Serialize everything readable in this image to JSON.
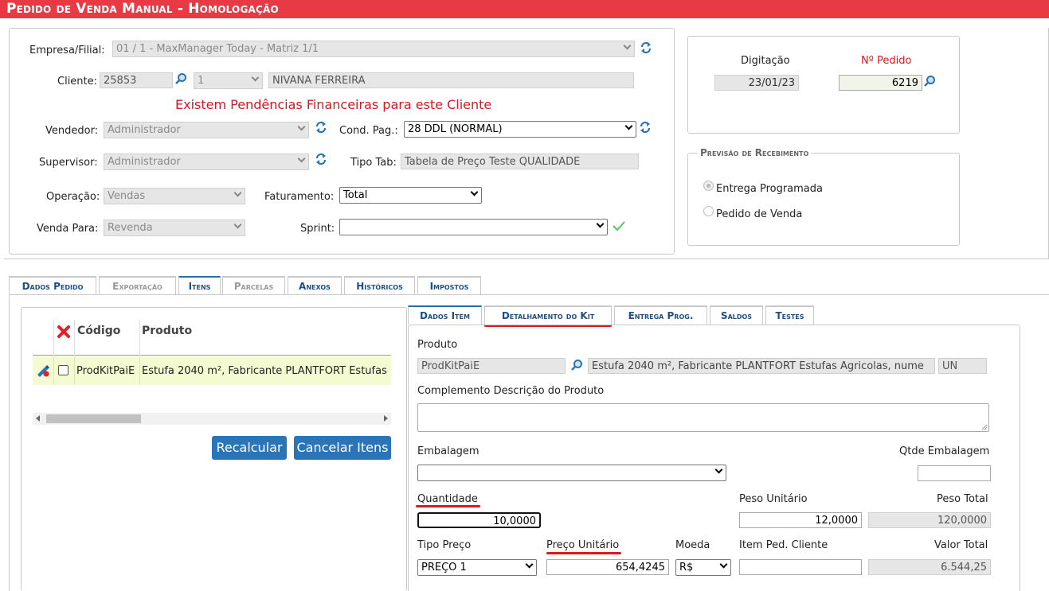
{
  "title": "Pedido de Venda Manual  - Homologação",
  "header": {
    "empresa_label": "Empresa/Filial:",
    "empresa_value": "01 / 1 - MaxManager Today - Matriz 1/1",
    "cliente_label": "Cliente:",
    "cliente_code": "25853",
    "cliente_branch": "1",
    "cliente_name": "NIVANA FERREIRA",
    "pendencias_msg": "Existem Pendências Financeiras para este Cliente",
    "vendedor_label": "Vendedor:",
    "vendedor_value": "Administrador",
    "cond_pag_label": "Cond. Pag.:",
    "cond_pag_value": "28 DDL (NORMAL)",
    "supervisor_label": "Supervisor:",
    "supervisor_value": "Administrador",
    "tipo_tab_label": "Tipo Tab:",
    "tipo_tab_value": "Tabela de Preço Teste QUALIDADE",
    "operacao_label": "Operação:",
    "operacao_value": "Vendas",
    "faturamento_label": "Faturamento:",
    "faturamento_value": "Total",
    "venda_para_label": "Venda Para:",
    "venda_para_value": "Revenda",
    "sprint_label": "Sprint:",
    "sprint_value": ""
  },
  "order_box": {
    "digitacao_label": "Digitação",
    "digitacao_value": "23/01/23",
    "pedido_label": "Nº Pedido",
    "pedido_value": "6219"
  },
  "previsao": {
    "legend": "Previsão de Recebimento",
    "option1": "Entrega Programada",
    "option2": "Pedido de Venda"
  },
  "main_tabs": [
    {
      "label": "Dados Pedido",
      "state": "normal"
    },
    {
      "label": "Exportação",
      "state": "disabled"
    },
    {
      "label": "Itens",
      "state": "active"
    },
    {
      "label": "Parcelas",
      "state": "disabled"
    },
    {
      "label": "Anexos",
      "state": "normal"
    },
    {
      "label": "Históricos",
      "state": "normal"
    },
    {
      "label": "Impostos",
      "state": "normal"
    }
  ],
  "items_grid": {
    "col_codigo": "Código",
    "col_produto": "Produto",
    "row_codigo": "ProdKitPaiE",
    "row_produto": "Estufa 2040 m², Fabricante PLANTFORT Estufas"
  },
  "buttons": {
    "recalcular": "Recalcular",
    "cancelar": "Cancelar Itens"
  },
  "sub_tabs": [
    {
      "label": "Dados Item"
    },
    {
      "label": "Detalhamento do Kit"
    },
    {
      "label": "Entrega Prog."
    },
    {
      "label": "Saldos"
    },
    {
      "label": "Testes"
    }
  ],
  "item": {
    "produto_label": "Produto",
    "produto_code": "ProdKitPaiE",
    "produto_desc": "Estufa 2040 m², Fabricante PLANTFORT Estufas Agricolas, nume",
    "produto_unit": "UN",
    "complemento_label": "Complemento Descrição do Produto",
    "embalagem_label": "Embalagem",
    "qtde_embalagem_label": "Qtde Embalagem",
    "quantidade_label": "Quantidade",
    "quantidade_value": "10,0000",
    "peso_unit_label": "Peso Unitário",
    "peso_unit_value": "12,0000",
    "peso_total_label": "Peso Total",
    "peso_total_value": "120,0000",
    "tipo_preco_label": "Tipo Preço",
    "tipo_preco_value": "PREÇO 1",
    "preco_unit_label": "Preço Unitário",
    "preco_unit_value": "654,4245",
    "moeda_label": "Moeda",
    "moeda_value": "R$",
    "item_ped_cliente_label": "Item Ped. Cliente",
    "valor_total_label": "Valor Total",
    "valor_total_value": "6.544,25"
  },
  "colors": {
    "title_bar": "#e83a45",
    "accent_blue": "#2a74b8",
    "highlight_red": "#d71920",
    "row_highlight": "#f5fbd0"
  }
}
